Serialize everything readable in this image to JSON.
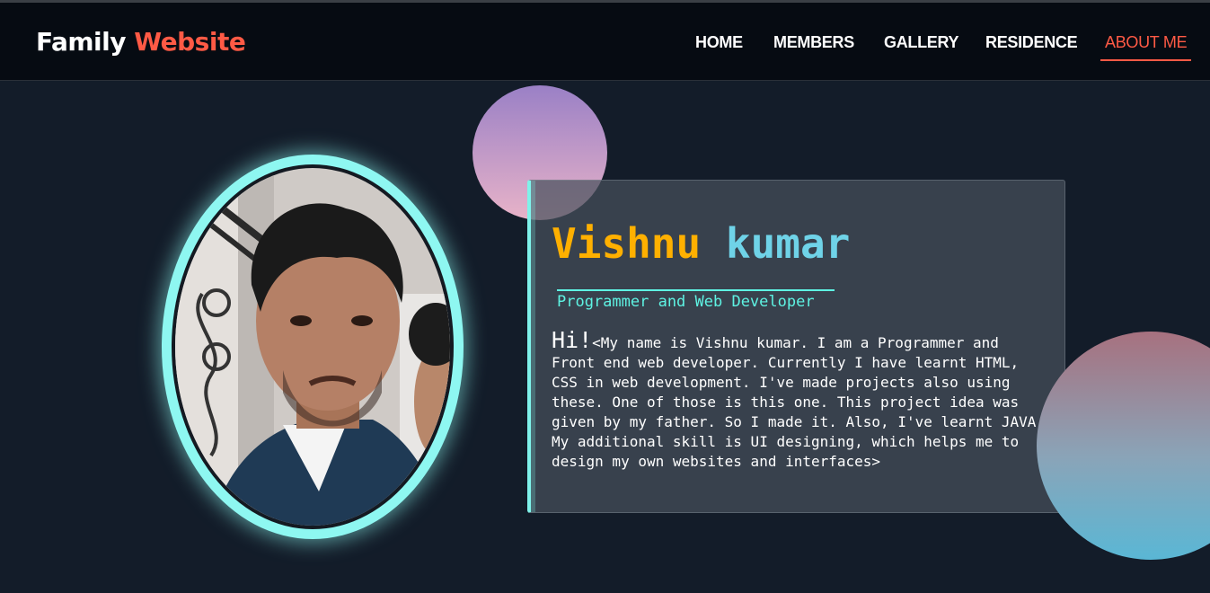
{
  "header": {
    "logo_part1": "Family",
    "logo_part2": "Website",
    "nav": [
      "HOME",
      "MEMBERS",
      "GALLERY",
      "RESIDENCE",
      "ABOUT ME"
    ],
    "active_index": 4
  },
  "profile": {
    "first_name": "Vishnu",
    "last_name": "kumar",
    "role": "Programmer and Web Developer",
    "greeting": "Hi!",
    "bio": "<My name is Vishnu kumar. I am a Programmer and Front end web developer. Currently I have learnt HTML, CSS in web development. I've made projects also using these. One of those is this one. This project idea was given by my father. So I made it. Also, I've learnt JAVA. My additional skill is UI designing, which helps me to design my own websites and interfaces>",
    "photo_icon": "portrait-photo"
  },
  "colors": {
    "accent": "#ff5a45",
    "name_first": "#ffb000",
    "name_last": "#6fd3e8",
    "cyan": "#5ef3e3",
    "background": "#131c29"
  }
}
